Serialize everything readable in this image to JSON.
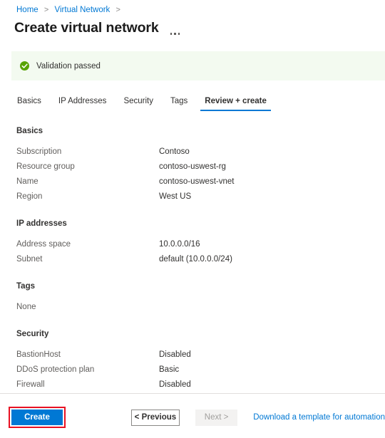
{
  "breadcrumb": {
    "items": [
      {
        "label": "Home"
      },
      {
        "label": "Virtual Network"
      }
    ],
    "separator": ">"
  },
  "header": {
    "title": "Create virtual network",
    "more_menu": "ellipsis-menu"
  },
  "validation": {
    "icon": "check-circle-icon",
    "message": "Validation passed",
    "background_color": "#f3faf0",
    "icon_color": "#57a300"
  },
  "tabs": [
    {
      "label": "Basics",
      "active": false
    },
    {
      "label": "IP Addresses",
      "active": false
    },
    {
      "label": "Security",
      "active": false
    },
    {
      "label": "Tags",
      "active": false
    },
    {
      "label": "Review + create",
      "active": true
    }
  ],
  "sections": {
    "basics": {
      "title": "Basics",
      "rows": [
        {
          "label": "Subscription",
          "value": "Contoso"
        },
        {
          "label": "Resource group",
          "value": "contoso-uswest-rg"
        },
        {
          "label": "Name",
          "value": "contoso-uswest-vnet"
        },
        {
          "label": "Region",
          "value": "West US"
        }
      ]
    },
    "ip_addresses": {
      "title": "IP addresses",
      "rows": [
        {
          "label": "Address space",
          "value": "10.0.0.0/16"
        },
        {
          "label": "Subnet",
          "value": "default (10.0.0.0/24)"
        }
      ]
    },
    "tags": {
      "title": "Tags",
      "empty_text": "None"
    },
    "security": {
      "title": "Security",
      "rows": [
        {
          "label": "BastionHost",
          "value": "Disabled"
        },
        {
          "label": "DDoS protection plan",
          "value": "Basic"
        },
        {
          "label": "Firewall",
          "value": "Disabled"
        }
      ]
    }
  },
  "footer": {
    "create_label": "Create",
    "previous_label": "< Previous",
    "next_label": "Next >",
    "download_link_label": "Download a template for automation",
    "accent_color": "#0078d4",
    "highlight_color": "#e81123"
  }
}
